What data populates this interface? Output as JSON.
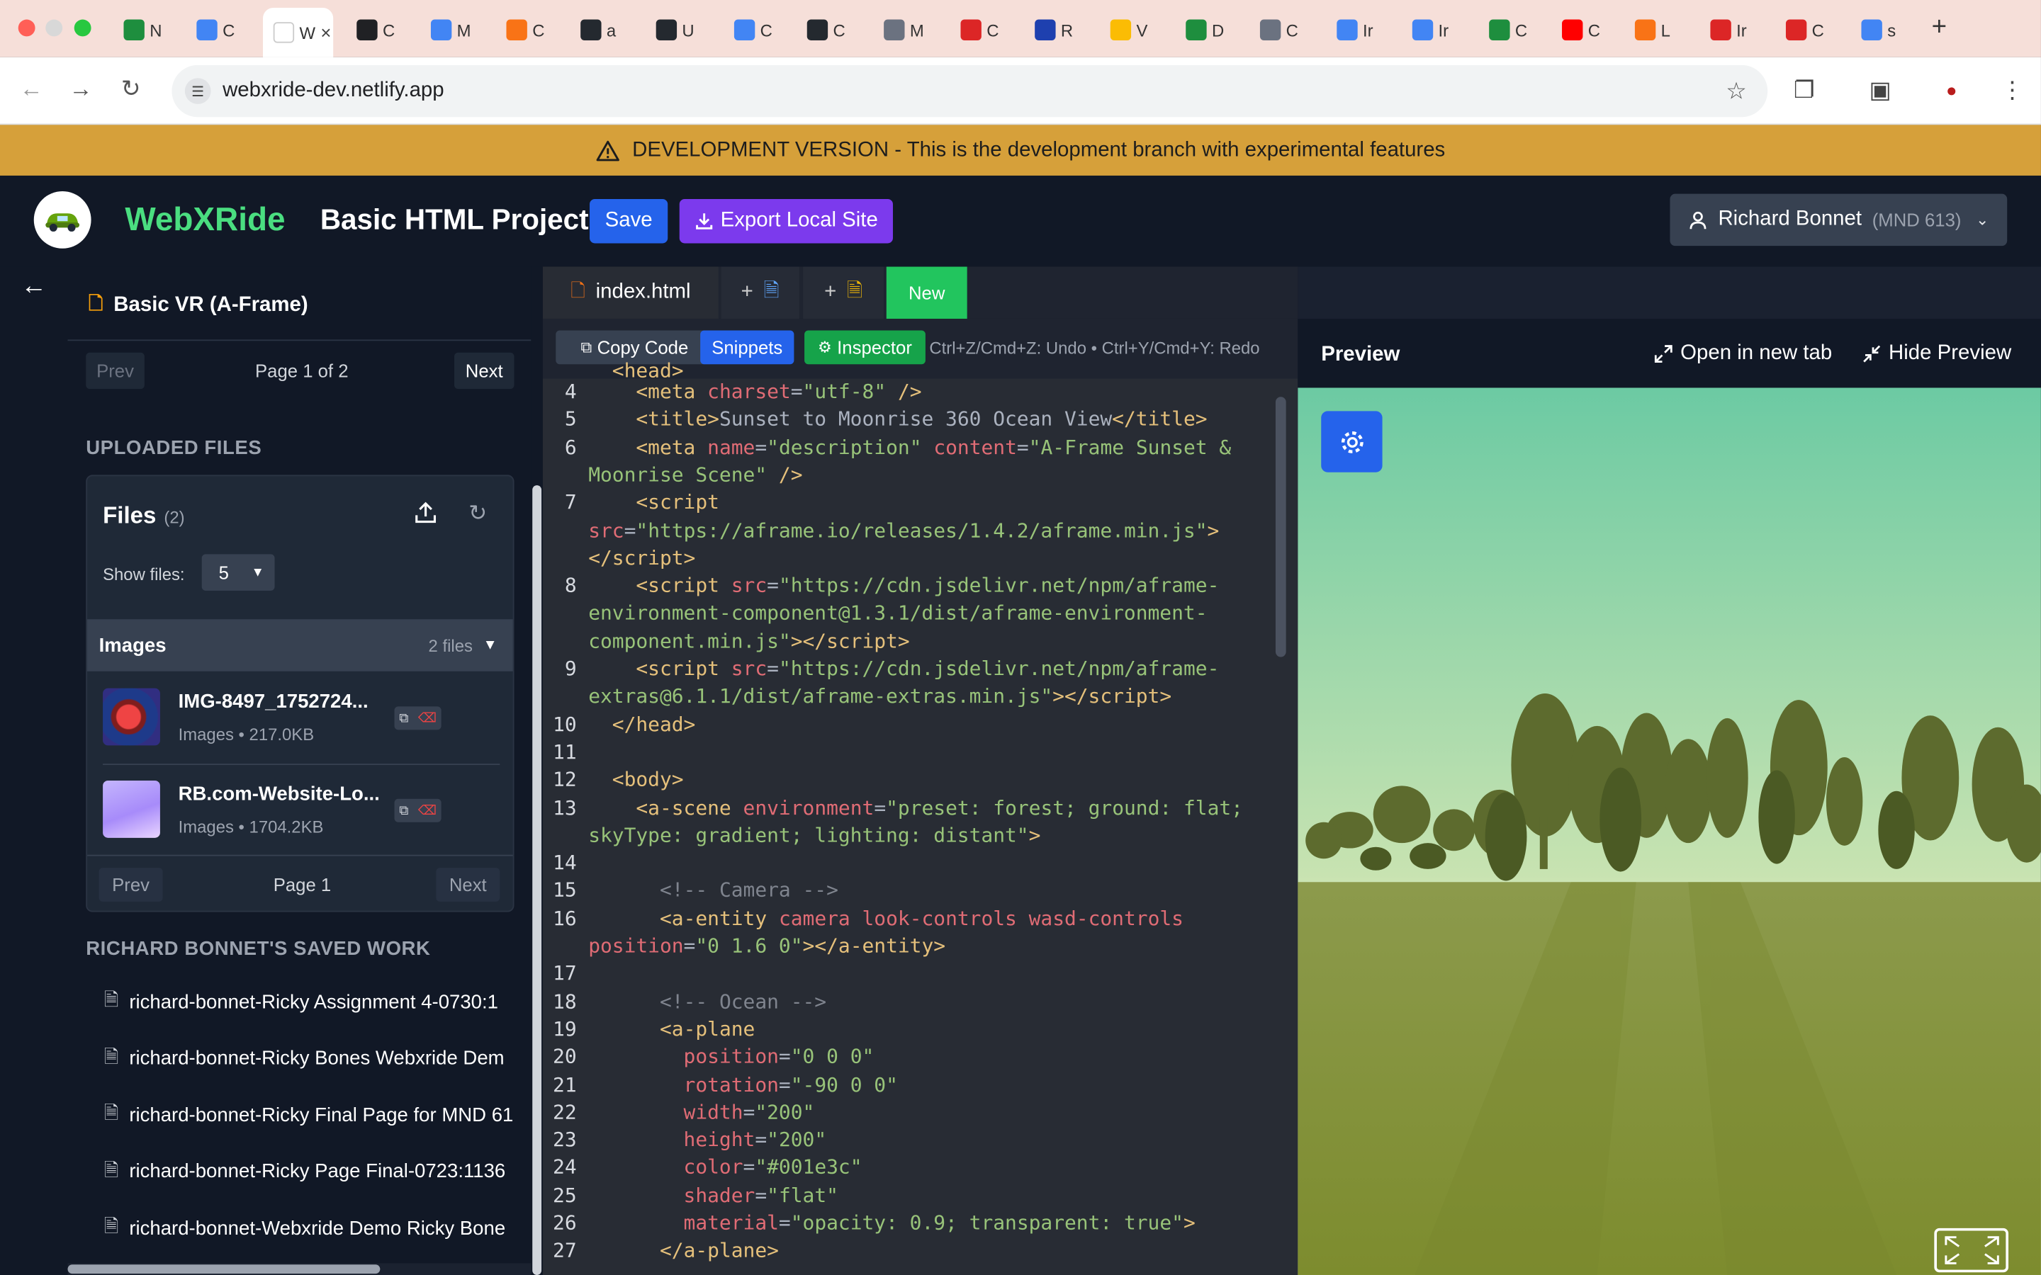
{
  "browser": {
    "tabs": [
      {
        "label": "N",
        "fav": "#1e8e3e"
      },
      {
        "label": "C",
        "fav": "#4285f4"
      },
      {
        "label": "W",
        "fav": "#ffffff",
        "active": true
      },
      {
        "label": "C",
        "fav": "#202124"
      },
      {
        "label": "M",
        "fav": "#4285f4"
      },
      {
        "label": "C",
        "fav": "#f97316"
      },
      {
        "label": "a",
        "fav": "#24292f"
      },
      {
        "label": "U",
        "fav": "#24292f"
      },
      {
        "label": "C",
        "fav": "#4285f4"
      },
      {
        "label": "C",
        "fav": "#24292f"
      },
      {
        "label": "M",
        "fav": "#6b7280"
      },
      {
        "label": "C",
        "fav": "#dc2626"
      },
      {
        "label": "R",
        "fav": "#1e40af"
      },
      {
        "label": "V",
        "fav": "#fbbc04"
      },
      {
        "label": "D",
        "fav": "#1e8e3e"
      },
      {
        "label": "C",
        "fav": "#6b7280"
      },
      {
        "label": "Ir",
        "fav": "#4285f4"
      },
      {
        "label": "Ir",
        "fav": "#4285f4"
      },
      {
        "label": "C",
        "fav": "#1e8e3e"
      },
      {
        "label": "C",
        "fav": "#ff0000"
      },
      {
        "label": "L",
        "fav": "#f97316"
      },
      {
        "label": "Ir",
        "fav": "#dc2626"
      },
      {
        "label": "C",
        "fav": "#dc2626"
      },
      {
        "label": "s",
        "fav": "#4285f4"
      }
    ],
    "new_tab": "+",
    "url": "webxride-dev.netlify.app"
  },
  "banner": {
    "text": "DEVELOPMENT VERSION - This is the development branch with experimental features"
  },
  "header": {
    "brand": "WebXRide",
    "project_title": "Basic HTML Project",
    "save_label": "Save",
    "export_label": "Export Local Site",
    "user_name": "Richard Bonnet",
    "user_course": "(MND 613)"
  },
  "sidebar": {
    "template_name": "Basic VR (A-Frame)",
    "templates_pager": {
      "prev": "Prev",
      "info": "Page 1 of 2",
      "next": "Next"
    },
    "uploaded_title": "UPLOADED FILES",
    "files": {
      "title": "Files",
      "count": "(2)",
      "show_label": "Show files:",
      "show_value": "5",
      "group_title": "Images",
      "group_count": "2 files",
      "items": [
        {
          "name": "IMG-8497_1752724...",
          "meta": "Images • 217.0KB"
        },
        {
          "name": "RB.com-Website-Lo...",
          "meta": "Images • 1704.2KB"
        }
      ],
      "pager": {
        "prev": "Prev",
        "info": "Page 1",
        "next": "Next"
      }
    },
    "saved_title": "RICHARD BONNET'S SAVED WORK",
    "saved_items": [
      "richard-bonnet-Ricky Assignment 4-0730:1",
      "richard-bonnet-Ricky Bones Webxride Dem",
      "richard-bonnet-Ricky Final Page for MND 61",
      "richard-bonnet-Ricky Page Final-0723:1136",
      "richard-bonnet-Webxride Demo Ricky Bone"
    ]
  },
  "editor": {
    "file_tab": "index.html",
    "new_tab": "New",
    "add_label": "+",
    "copy_label": "Copy Code",
    "snippets_label": "Snippets",
    "inspector_label": "Inspector",
    "hint": "Ctrl+Z/Cmd+Z: Undo • Ctrl+Y/Cmd+Y: Redo",
    "lines": [
      {
        "n": "",
        "html": "  <span class='tag'>&lt;head&gt;</span>",
        "y": -16
      },
      {
        "n": "4",
        "html": "    <span class='tag'>&lt;meta</span> <span class='attr'>charset</span>=<span class='str'>\"utf-8\"</span> <span class='tag'>/&gt;</span>"
      },
      {
        "n": "5",
        "html": "    <span class='tag'>&lt;title&gt;</span>Sunset to Moonrise 360 Ocean View<span class='tag'>&lt;/title&gt;</span>"
      },
      {
        "n": "6",
        "html": "    <span class='tag'>&lt;meta</span> <span class='attr'>name</span>=<span class='str'>\"description\"</span> <span class='attr'>content</span>=<span class='str'>\"A-Frame Sunset &amp;</span>"
      },
      {
        "n": "",
        "html": "<span class='str'>Moonrise Scene\"</span> <span class='tag'>/&gt;</span>"
      },
      {
        "n": "7",
        "html": "    <span class='tag'>&lt;script</span>"
      },
      {
        "n": "",
        "html": "<span class='attr'>src</span>=<span class='str'>\"https://aframe.io/releases/1.4.2/aframe.min.js\"</span><span class='tag'>&gt;</span>"
      },
      {
        "n": "",
        "html": "<span class='tag'>&lt;/script&gt;</span>"
      },
      {
        "n": "8",
        "html": "    <span class='tag'>&lt;script</span> <span class='attr'>src</span>=<span class='str'>\"https://cdn.jsdelivr.net/npm/aframe-</span>"
      },
      {
        "n": "",
        "html": "<span class='str'>environment-component@1.3.1/dist/aframe-environment-</span>"
      },
      {
        "n": "",
        "html": "<span class='str'>component.min.js\"</span><span class='tag'>&gt;&lt;/script&gt;</span>"
      },
      {
        "n": "9",
        "html": "    <span class='tag'>&lt;script</span> <span class='attr'>src</span>=<span class='str'>\"https://cdn.jsdelivr.net/npm/aframe-</span>"
      },
      {
        "n": "",
        "html": "<span class='str'>extras@6.1.1/dist/aframe-extras.min.js\"</span><span class='tag'>&gt;&lt;/script&gt;</span>"
      },
      {
        "n": "10",
        "html": "  <span class='tag'>&lt;/head&gt;</span>"
      },
      {
        "n": "11",
        "html": ""
      },
      {
        "n": "12",
        "html": "  <span class='tag'>&lt;body&gt;</span>"
      },
      {
        "n": "13",
        "html": "    <span class='tag'>&lt;a-scene</span> <span class='attr'>environment</span>=<span class='str'>\"preset: forest; ground: flat;</span>"
      },
      {
        "n": "",
        "html": "<span class='str'>skyType: gradient; lighting: distant\"</span><span class='tag'>&gt;</span>"
      },
      {
        "n": "14",
        "html": ""
      },
      {
        "n": "15",
        "html": "      <span class='cmt'>&lt;!-- Camera --&gt;</span>"
      },
      {
        "n": "16",
        "html": "      <span class='tag'>&lt;a-entity</span> <span class='attr'>camera look-controls wasd-controls</span>"
      },
      {
        "n": "",
        "html": "<span class='attr'>position</span>=<span class='str'>\"0 1.6 0\"</span><span class='tag'>&gt;&lt;/a-entity&gt;</span>"
      },
      {
        "n": "17",
        "html": ""
      },
      {
        "n": "18",
        "html": "      <span class='cmt'>&lt;!-- Ocean --&gt;</span>"
      },
      {
        "n": "19",
        "html": "      <span class='tag'>&lt;a-plane</span>"
      },
      {
        "n": "20",
        "html": "        <span class='attr'>position</span>=<span class='str'>\"0 0 0\"</span>"
      },
      {
        "n": "21",
        "html": "        <span class='attr'>rotation</span>=<span class='str'>\"-90 0 0\"</span>"
      },
      {
        "n": "22",
        "html": "        <span class='attr'>width</span>=<span class='str'>\"200\"</span>"
      },
      {
        "n": "23",
        "html": "        <span class='attr'>height</span>=<span class='str'>\"200\"</span>"
      },
      {
        "n": "24",
        "html": "        <span class='attr'>color</span>=<span class='str'>\"#001e3c\"</span>"
      },
      {
        "n": "25",
        "html": "        <span class='attr'>shader</span>=<span class='str'>\"flat\"</span>"
      },
      {
        "n": "26",
        "html": "        <span class='attr'>material</span>=<span class='str'>\"opacity: 0.9; transparent: true\"</span><span class='tag'>&gt;</span>"
      },
      {
        "n": "27",
        "html": "      <span class='tag'>&lt;/a-plane&gt;</span>"
      }
    ]
  },
  "preview": {
    "title": "Preview",
    "open_label": "Open in new tab",
    "hide_label": "Hide Preview"
  },
  "colors": {
    "accent_green": "#4ade80",
    "save_blue": "#2563eb",
    "export_purple": "#7c3aed",
    "banner": "#d6a03a"
  }
}
